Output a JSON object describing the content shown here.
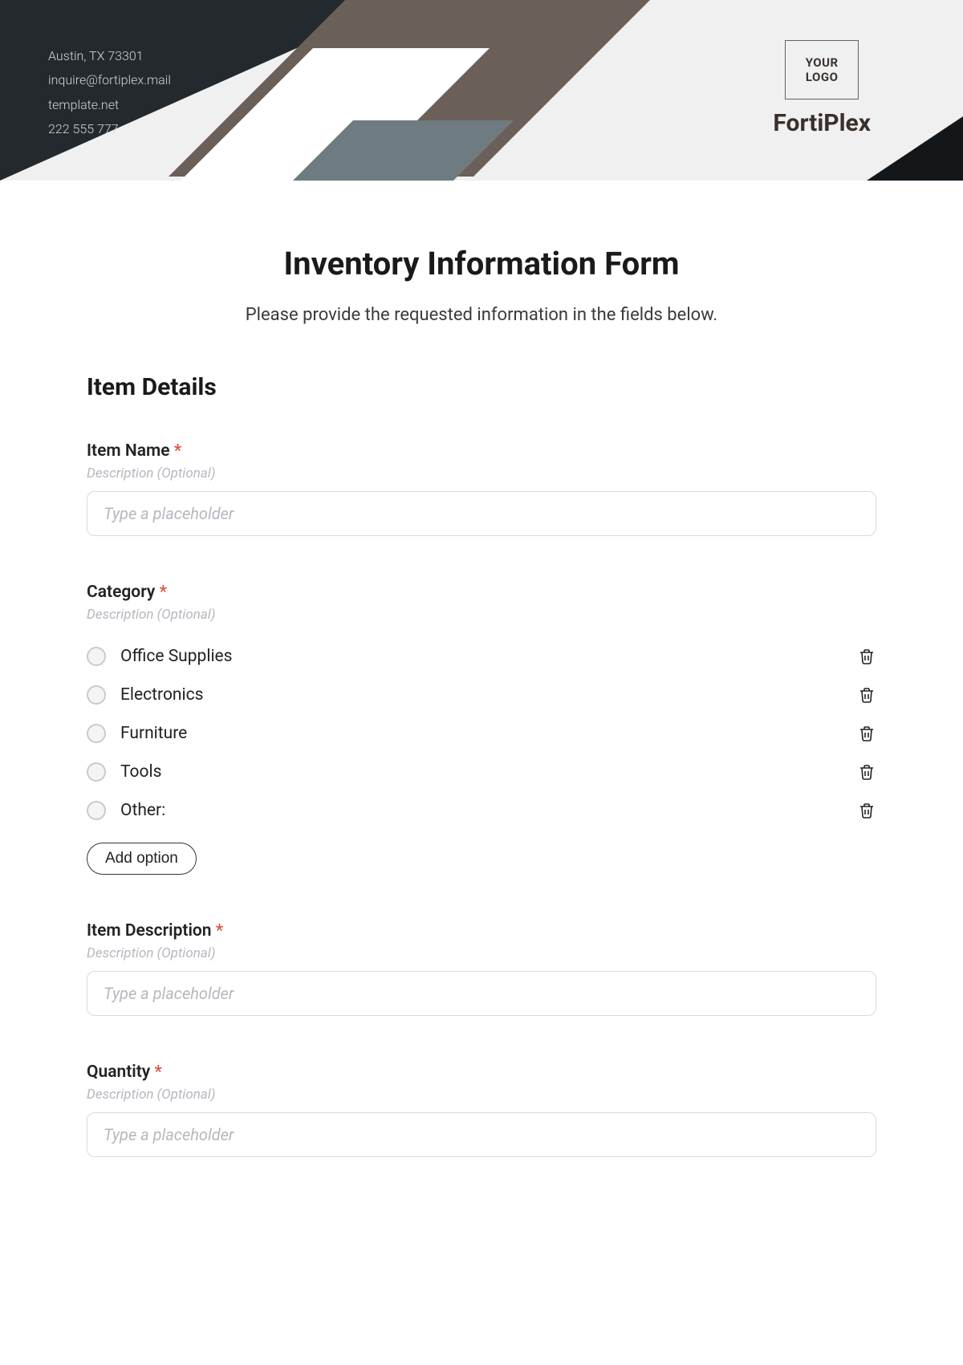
{
  "header": {
    "contact": {
      "address": "Austin, TX 73301",
      "email": "inquire@fortiplex.mail",
      "website": "template.net",
      "phone": "222 555 777"
    },
    "logo_text": "YOUR\nLOGO",
    "brand": "FortiPlex"
  },
  "form": {
    "title": "Inventory Information Form",
    "subtitle": "Please provide the requested information in the fields below.",
    "section_title": "Item Details",
    "desc_hint": "Description (Optional)",
    "required_mark": "*",
    "input_placeholder": "Type a placeholder",
    "add_option_label": "Add option",
    "fields": {
      "item_name": {
        "label": "Item Name"
      },
      "category": {
        "label": "Category",
        "options": [
          "Office Supplies",
          "Electronics",
          "Furniture",
          "Tools",
          "Other:"
        ]
      },
      "item_description": {
        "label": "Item Description"
      },
      "quantity": {
        "label": "Quantity"
      }
    }
  }
}
